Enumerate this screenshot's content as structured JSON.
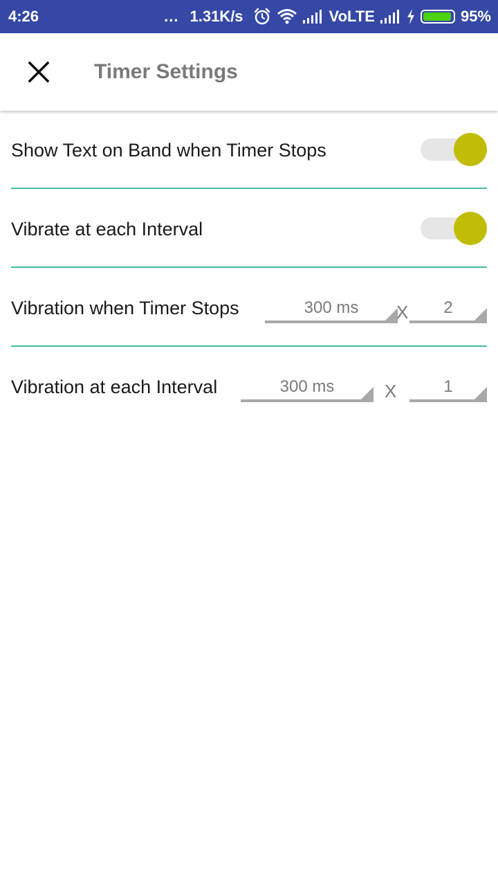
{
  "status_bar": {
    "time": "4:26",
    "dots": "...",
    "network_speed": "1.31K/s",
    "network_type": "VoLTE",
    "battery_percent": "95%",
    "battery_level": 0.95,
    "icons": [
      "alarm-icon",
      "wifi-icon",
      "signal-icon",
      "charging-icon",
      "battery-icon"
    ]
  },
  "app_bar": {
    "title": "Timer Settings",
    "close_icon": "close-icon"
  },
  "settings": {
    "show_text": {
      "label": "Show Text on Band when Timer Stops",
      "enabled": true
    },
    "vibrate_interval": {
      "label": "Vibrate at each Interval",
      "enabled": true
    },
    "vibration_stop": {
      "label": "Vibration when Timer Stops",
      "duration": "300 ms",
      "times_symbol": "X",
      "count": "2"
    },
    "vibration_interval": {
      "label": "Vibration at each Interval",
      "duration": "300 ms",
      "times_symbol": "X",
      "count": "1"
    }
  },
  "colors": {
    "status_bar": "#3548a5",
    "accent": "#c1bd06",
    "divider": "#3dbf9e",
    "title_text": "#7a7a7a"
  }
}
